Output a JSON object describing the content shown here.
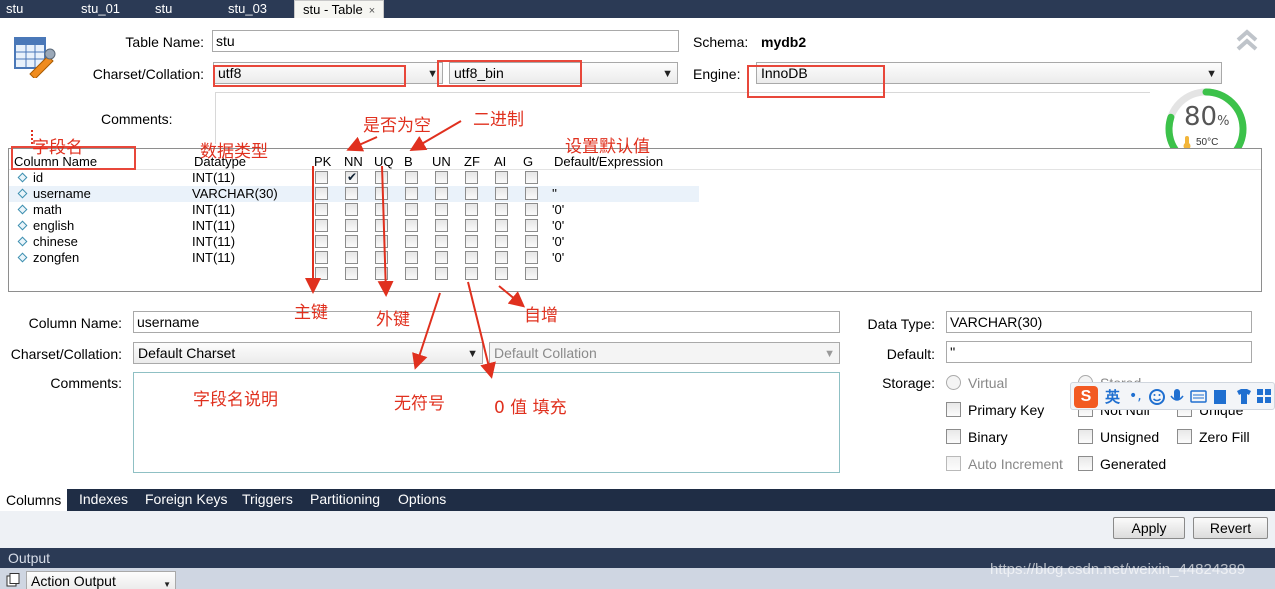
{
  "tabs": [
    {
      "label": "stu"
    },
    {
      "label": "stu_01"
    },
    {
      "label": "stu"
    },
    {
      "label": "stu_03"
    },
    {
      "label": "stu - Table"
    }
  ],
  "tab_close_glyph": "×",
  "form": {
    "table_name_label": "Table Name:",
    "table_name_value": "stu",
    "schema_label": "Schema:",
    "schema_value": "mydb2",
    "charset_label": "Charset/Collation:",
    "charset_value": "utf8",
    "collation_value": "utf8_bin",
    "engine_label": "Engine:",
    "engine_value": "InnoDB",
    "comments_label": "Comments:"
  },
  "widget": {
    "percent": "80",
    "percent_sign": "%",
    "temperature": "50°C",
    "level": 0.8
  },
  "grid": {
    "headers": [
      "Column Name",
      "Datatype",
      "PK",
      "NN",
      "UQ",
      "B",
      "UN",
      "ZF",
      "AI",
      "G",
      "Default/Expression"
    ],
    "rows": [
      {
        "name": "id",
        "type": "INT(11)",
        "flags": [
          false,
          true,
          false,
          false,
          false,
          false,
          false,
          false
        ],
        "default": ""
      },
      {
        "name": "username",
        "type": "VARCHAR(30)",
        "flags": [
          false,
          false,
          false,
          false,
          false,
          false,
          false,
          false
        ],
        "default": "''"
      },
      {
        "name": "math",
        "type": "INT(11)",
        "flags": [
          false,
          false,
          false,
          false,
          false,
          false,
          false,
          false
        ],
        "default": "'0'"
      },
      {
        "name": "english",
        "type": "INT(11)",
        "flags": [
          false,
          false,
          false,
          false,
          false,
          false,
          false,
          false
        ],
        "default": "'0'"
      },
      {
        "name": "chinese",
        "type": "INT(11)",
        "flags": [
          false,
          false,
          false,
          false,
          false,
          false,
          false,
          false
        ],
        "default": "'0'"
      },
      {
        "name": "zongfen",
        "type": "INT(11)",
        "flags": [
          false,
          false,
          false,
          false,
          false,
          false,
          false,
          false
        ],
        "default": "'0'"
      }
    ]
  },
  "detail": {
    "column_name_label": "Column Name:",
    "column_name_value": "username",
    "charset_label": "Charset/Collation:",
    "charset_value": "Default Charset",
    "collation_value": "Default Collation",
    "comments_label": "Comments:",
    "data_type_label": "Data Type:",
    "data_type_value": "VARCHAR(30)",
    "default_label": "Default:",
    "default_value": "''",
    "storage_label": "Storage:",
    "virtual_label": "Virtual",
    "stored_label": "Stored",
    "primary_key_label": "Primary Key",
    "not_null_label": "Not Null",
    "unique_label": "Unique",
    "binary_label": "Binary",
    "unsigned_label": "Unsigned",
    "zero_fill_label": "Zero Fill",
    "auto_increment_label": "Auto Increment",
    "generated_label": "Generated"
  },
  "ime_bar": {
    "logo": "S",
    "lang": "英"
  },
  "annotations": {
    "field_name": "字段名",
    "data_type": "数据类型",
    "is_null": "是否为空",
    "binary": "二进制",
    "default_value": "设置默认值",
    "primary_key": "主键",
    "foreign_key": "外键",
    "auto_inc": "自增",
    "unsigned": "无符号",
    "zero_fill": "0 值 填充",
    "field_desc": "字段名说明"
  },
  "bottom_tabs": [
    "Columns",
    "Indexes",
    "Foreign Keys",
    "Triggers",
    "Partitioning",
    "Options"
  ],
  "buttons": {
    "apply": "Apply",
    "revert": "Revert"
  },
  "output": {
    "title": "Output",
    "dropdown": "Action Output"
  },
  "watermark": "https://blog.csdn.net/weixin_44824389",
  "colors": {
    "annotation": "#e0301e",
    "tab_bar": "#2b3a55",
    "gauge": "#3cc24a"
  }
}
